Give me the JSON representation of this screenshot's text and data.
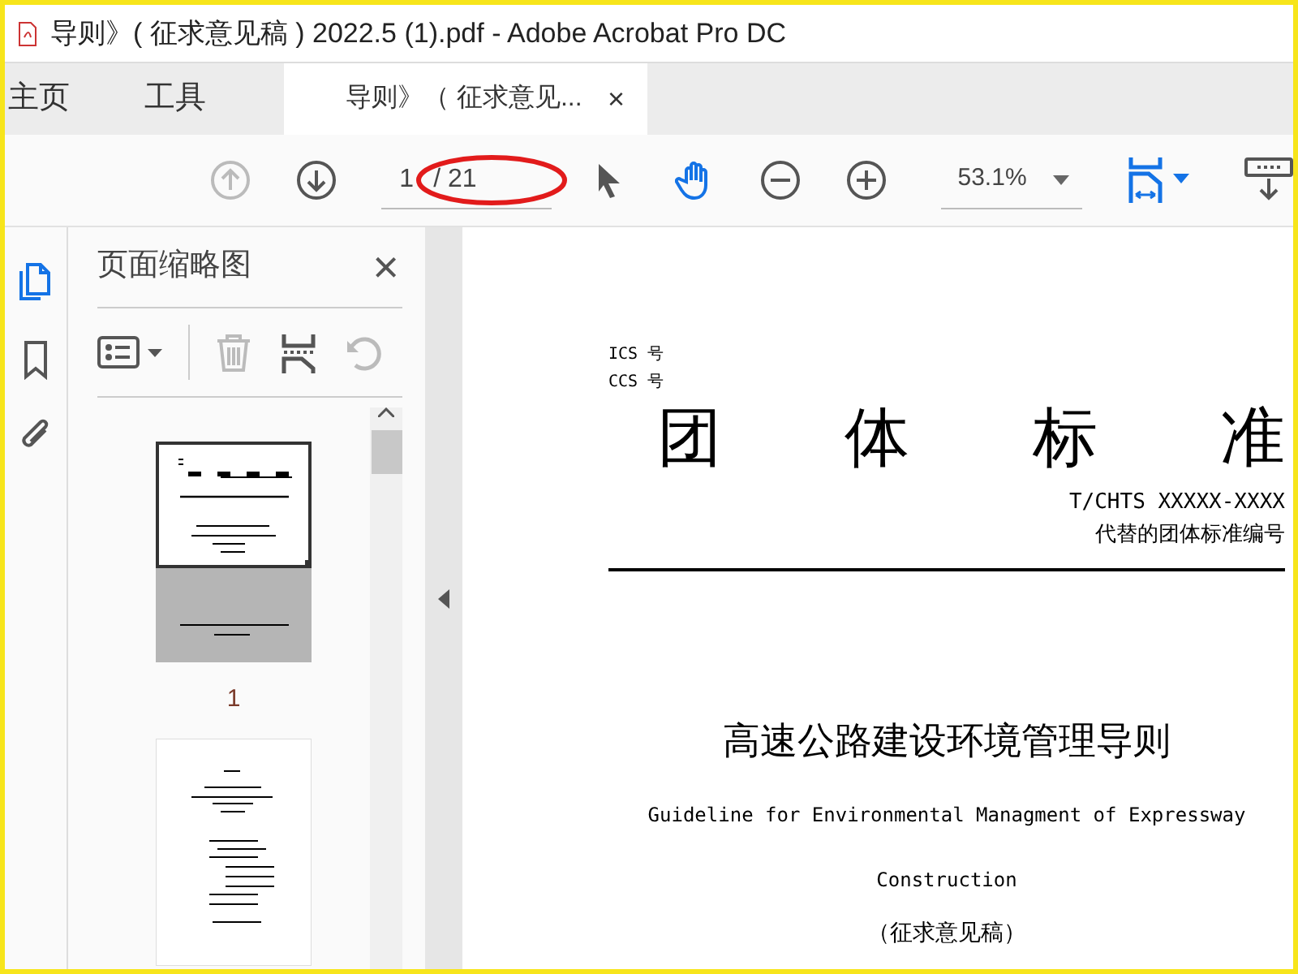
{
  "window": {
    "title": "导则》( 征求意见稿 ) 2022.5 (1).pdf - Adobe Acrobat Pro DC"
  },
  "tabs": [
    {
      "label": "主页",
      "selected": false
    },
    {
      "label": "工具",
      "selected": false
    },
    {
      "label": "导则》（ 征求意见...",
      "selected": true,
      "close": "×"
    }
  ],
  "toolbar": {
    "buttons": [
      {
        "kind": "prev-page",
        "disabled": true
      },
      {
        "kind": "next-page",
        "disabled": false
      }
    ],
    "page_field": {
      "value": "1",
      "total": "/ 21"
    },
    "tools": [
      {
        "kind": "select",
        "selected": false
      },
      {
        "kind": "hand",
        "selected": true
      },
      {
        "kind": "zoom-out",
        "selected": false
      },
      {
        "kind": "zoom-in",
        "selected": false
      }
    ],
    "zoom_field": {
      "value": "53.1%"
    }
  },
  "side_rail": [
    {
      "kind": "pages",
      "selected": true
    },
    {
      "kind": "bookmarks",
      "selected": false
    },
    {
      "kind": "attachments",
      "selected": false
    }
  ],
  "thumbnails_panel": {
    "title": "页面缩略图",
    "close": "×",
    "tools": [
      {
        "kind": "options",
        "disabled": false
      },
      {
        "kind": "delete",
        "disabled": true
      },
      {
        "kind": "insert",
        "disabled": false
      },
      {
        "kind": "rotate",
        "disabled": true
      }
    ],
    "thumbnails": [
      {
        "label": "1",
        "selected": true
      },
      {
        "selected": false
      }
    ]
  },
  "document": {
    "ics": "ICS 号",
    "ccs": "CCS 号",
    "heading_chars": [
      "团",
      "体",
      "标",
      "准"
    ],
    "code": "T/CHTS XXXXX-XXXX",
    "replaces": "代替的团体标准编号",
    "title_cn": "高速公路建设环境管理导则",
    "title_en": "Guideline for Environmental Managment of Expressway",
    "title_en_2": "Construction",
    "status": "（征求意见稿）"
  }
}
